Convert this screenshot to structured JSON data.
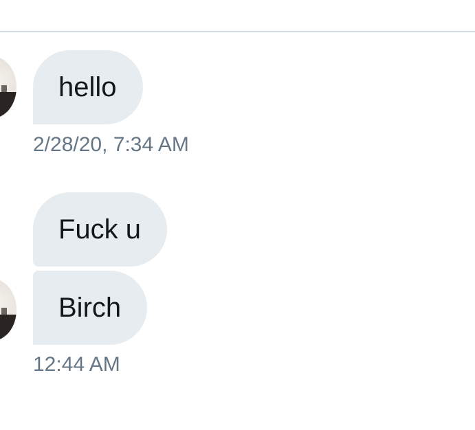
{
  "conversation": {
    "messages": [
      {
        "text": "hello"
      },
      {
        "text": "Fuck u"
      },
      {
        "text": "Birch"
      }
    ],
    "timestamps": [
      "2/28/20, 7:34 AM",
      "12:44 AM"
    ]
  },
  "colors": {
    "bubble_background": "#e6ecf0",
    "message_text": "#14171a",
    "timestamp_text": "#657786",
    "divider": "#d3dbe2"
  }
}
